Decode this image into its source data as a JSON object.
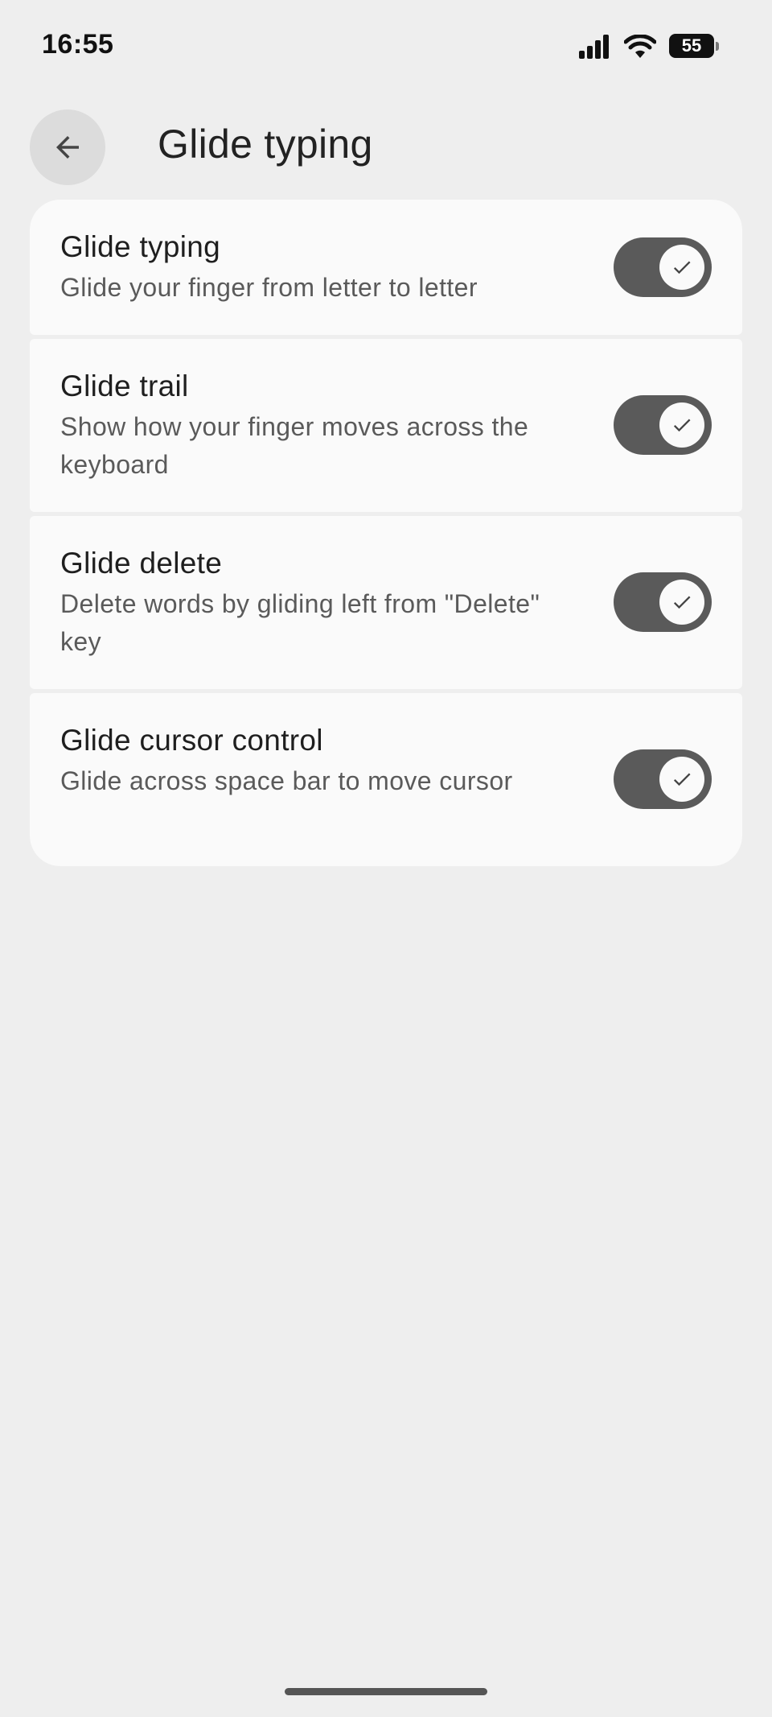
{
  "status_bar": {
    "time": "16:55",
    "battery": "55",
    "icons": [
      "signal-icon",
      "wifi-icon",
      "battery-icon"
    ]
  },
  "header": {
    "title": "Glide typing",
    "back_icon": "arrow-back-icon"
  },
  "settings": [
    {
      "title": "Glide typing",
      "description": "Glide your finger from letter to letter",
      "enabled": true
    },
    {
      "title": "Glide trail",
      "description": "Show how your finger moves across the keyboard",
      "enabled": true
    },
    {
      "title": "Glide delete",
      "description": "Delete words by gliding left from \"Delete\" key",
      "enabled": true
    },
    {
      "title": "Glide cursor control",
      "description": "Glide across space bar to move cursor",
      "enabled": true
    }
  ],
  "colors": {
    "background": "#eeeeee",
    "card": "#fafafa",
    "toggle_track": "#5a5a5a",
    "toggle_knob": "#fafafa"
  }
}
